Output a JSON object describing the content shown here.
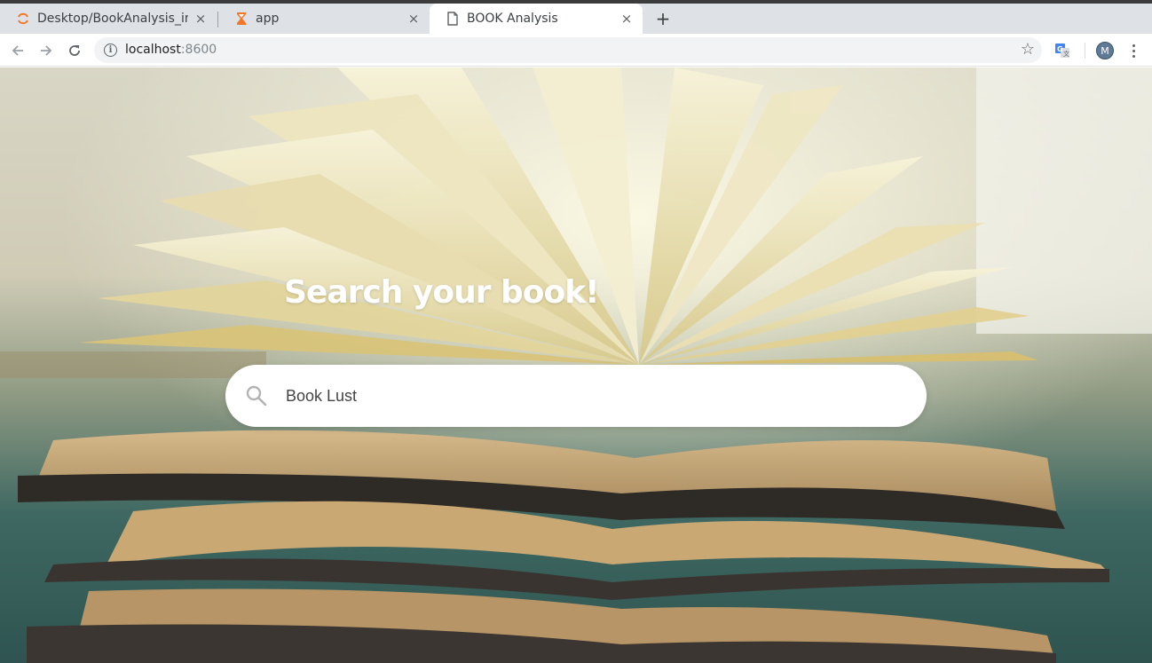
{
  "browser": {
    "tabs": [
      {
        "title": "Desktop/BookAnalysis_in",
        "icon": "jupyter-icon",
        "close": "×"
      },
      {
        "title": "app",
        "icon": "hourglass-icon",
        "close": "×"
      },
      {
        "title": "BOOK Analysis",
        "icon": "page-icon",
        "close": "×",
        "active": true
      }
    ],
    "new_tab": "+",
    "address": {
      "host": "localhost",
      "port": ":8600"
    },
    "avatar_initial": "M"
  },
  "hero": {
    "headline": "Search your book!",
    "search_value": "Book Lust",
    "search_placeholder": "Book Lust"
  },
  "colors": {
    "tab_bar": "#dee1e6",
    "accent_orange": "#f37726",
    "search_bg": "#ffffff",
    "headline": "#ffffff"
  }
}
